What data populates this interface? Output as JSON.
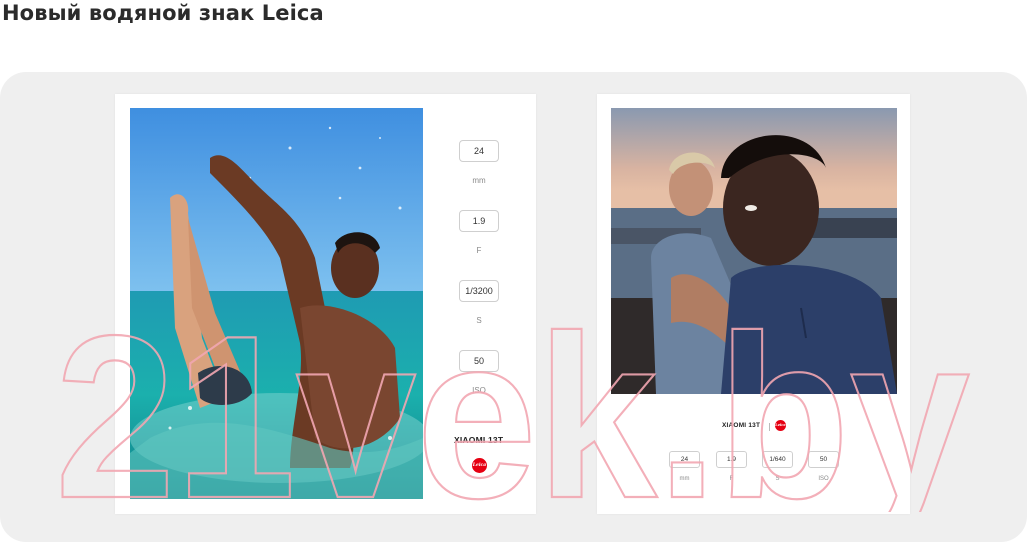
{
  "title": "Новый водяной знак Leica",
  "left_card": {
    "params": [
      {
        "value": "24",
        "unit": "mm"
      },
      {
        "value": "1.9",
        "unit": "F"
      },
      {
        "value": "1/3200",
        "unit": "S"
      },
      {
        "value": "50",
        "unit": "ISO"
      }
    ],
    "brand": "XIAOMI 13T",
    "logo_text": "Leica"
  },
  "right_card": {
    "brand": "XIAOMI 13T",
    "logo_text": "Leica",
    "params": [
      {
        "value": "24",
        "unit": "mm"
      },
      {
        "value": "1.9",
        "unit": "F"
      },
      {
        "value": "1/640",
        "unit": "S"
      },
      {
        "value": "50",
        "unit": "ISO"
      }
    ]
  },
  "watermark_text": "21vek.by",
  "colors": {
    "leica_red": "#e60012",
    "stage_bg": "#efefef",
    "watermark_pink": "#f2a7b2"
  }
}
